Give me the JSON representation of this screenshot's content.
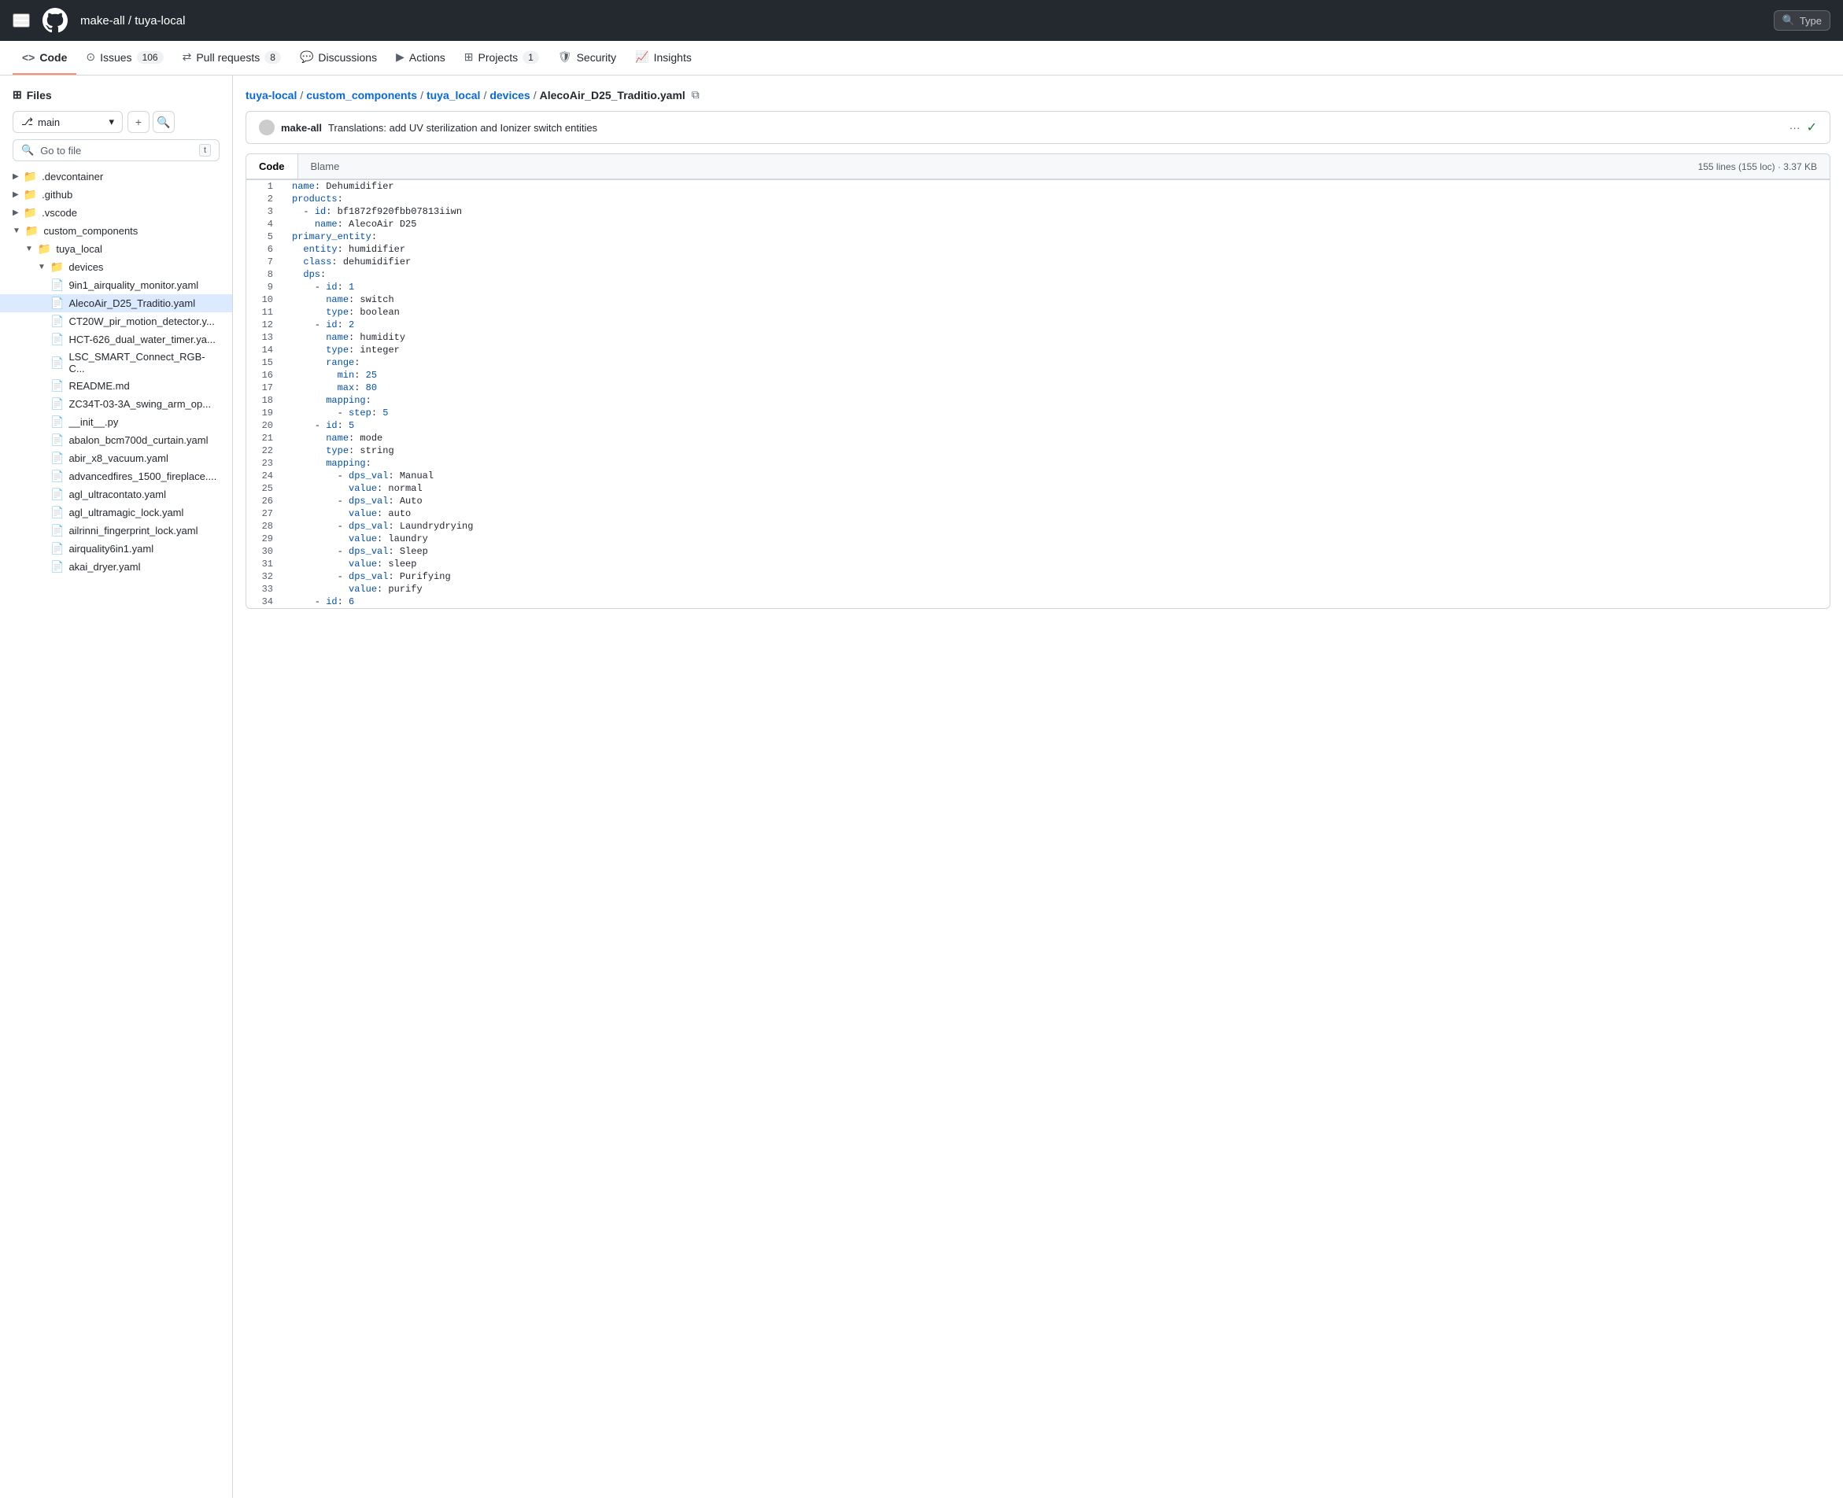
{
  "topNav": {
    "repoOwner": "make-all",
    "repoName": "tuya-local",
    "searchPlaceholder": "Type"
  },
  "tabs": [
    {
      "id": "code",
      "label": "Code",
      "icon": "code",
      "active": true
    },
    {
      "id": "issues",
      "label": "Issues",
      "icon": "circle-dot",
      "badge": "106"
    },
    {
      "id": "pulls",
      "label": "Pull requests",
      "icon": "git-pull-request",
      "badge": "8"
    },
    {
      "id": "discussions",
      "label": "Discussions",
      "icon": "comment"
    },
    {
      "id": "actions",
      "label": "Actions",
      "icon": "play-circle"
    },
    {
      "id": "projects",
      "label": "Projects",
      "icon": "table",
      "badge": "1"
    },
    {
      "id": "security",
      "label": "Security",
      "icon": "shield"
    },
    {
      "id": "insights",
      "label": "Insights",
      "icon": "graph"
    }
  ],
  "sidebar": {
    "filesTitle": "Files",
    "branch": "main",
    "goToFilePlaceholder": "Go to file",
    "goToFileShortcut": "t",
    "tree": [
      {
        "id": "devcontainer",
        "name": ".devcontainer",
        "type": "folder",
        "depth": 0,
        "expanded": false
      },
      {
        "id": "github",
        "name": ".github",
        "type": "folder",
        "depth": 0,
        "expanded": false
      },
      {
        "id": "vscode",
        "name": ".vscode",
        "type": "folder",
        "depth": 0,
        "expanded": false
      },
      {
        "id": "custom_components",
        "name": "custom_components",
        "type": "folder",
        "depth": 0,
        "expanded": true
      },
      {
        "id": "tuya_local",
        "name": "tuya_local",
        "type": "folder",
        "depth": 1,
        "expanded": true
      },
      {
        "id": "devices",
        "name": "devices",
        "type": "folder",
        "depth": 2,
        "expanded": true
      },
      {
        "id": "file_9in1",
        "name": "9in1_airquality_monitor.yaml",
        "type": "file",
        "depth": 3
      },
      {
        "id": "file_aleco",
        "name": "AlecoAir_D25_Traditio.yaml",
        "type": "file",
        "depth": 3,
        "active": true
      },
      {
        "id": "file_ct20w",
        "name": "CT20W_pir_motion_detector.y...",
        "type": "file",
        "depth": 3
      },
      {
        "id": "file_hct",
        "name": "HCT-626_dual_water_timer.ya...",
        "type": "file",
        "depth": 3
      },
      {
        "id": "file_lsc",
        "name": "LSC_SMART_Connect_RGB-C...",
        "type": "file",
        "depth": 3
      },
      {
        "id": "file_readme",
        "name": "README.md",
        "type": "file",
        "depth": 3
      },
      {
        "id": "file_zc34t",
        "name": "ZC34T-03-3A_swing_arm_op...",
        "type": "file",
        "depth": 3
      },
      {
        "id": "file_init",
        "name": "__init__.py",
        "type": "file",
        "depth": 3
      },
      {
        "id": "file_abalon",
        "name": "abalon_bcm700d_curtain.yaml",
        "type": "file",
        "depth": 3
      },
      {
        "id": "file_abir",
        "name": "abir_x8_vacuum.yaml",
        "type": "file",
        "depth": 3
      },
      {
        "id": "file_advfires",
        "name": "advancedfires_1500_fireplace....",
        "type": "file",
        "depth": 3
      },
      {
        "id": "file_agl_ultra",
        "name": "agl_ultracontato.yaml",
        "type": "file",
        "depth": 3
      },
      {
        "id": "file_agl_magic",
        "name": "agl_ultramagic_lock.yaml",
        "type": "file",
        "depth": 3
      },
      {
        "id": "file_ailrinni",
        "name": "ailrinni_fingerprint_lock.yaml",
        "type": "file",
        "depth": 3
      },
      {
        "id": "file_airq6",
        "name": "airquality6in1.yaml",
        "type": "file",
        "depth": 3
      },
      {
        "id": "file_akai",
        "name": "akai_dryer.yaml",
        "type": "file",
        "depth": 3
      }
    ]
  },
  "breadcrumb": {
    "parts": [
      {
        "label": "tuya-local",
        "link": true
      },
      {
        "label": "custom_components",
        "link": true
      },
      {
        "label": "tuya_local",
        "link": true
      },
      {
        "label": "devices",
        "link": true
      },
      {
        "label": "AlecoAir_D25_Traditio.yaml",
        "link": false
      }
    ]
  },
  "commitBar": {
    "author": "make-all",
    "message": "Translations: add UV sterilization and Ionizer switch entities",
    "statusIcon": "✓"
  },
  "codeView": {
    "activeTab": "Code",
    "blameTab": "Blame",
    "fileInfo": "155 lines (155 loc) · 3.37 KB",
    "lines": [
      {
        "num": 1,
        "code": "name: Dehumidifier"
      },
      {
        "num": 2,
        "code": "products:"
      },
      {
        "num": 3,
        "code": "  - id: bf1872f920fbb07813iiwn"
      },
      {
        "num": 4,
        "code": "    name: AlecoAir D25"
      },
      {
        "num": 5,
        "code": "primary_entity:"
      },
      {
        "num": 6,
        "code": "  entity: humidifier"
      },
      {
        "num": 7,
        "code": "  class: dehumidifier"
      },
      {
        "num": 8,
        "code": "  dps:"
      },
      {
        "num": 9,
        "code": "    - id: 1"
      },
      {
        "num": 10,
        "code": "      name: switch"
      },
      {
        "num": 11,
        "code": "      type: boolean"
      },
      {
        "num": 12,
        "code": "    - id: 2"
      },
      {
        "num": 13,
        "code": "      name: humidity"
      },
      {
        "num": 14,
        "code": "      type: integer"
      },
      {
        "num": 15,
        "code": "      range:"
      },
      {
        "num": 16,
        "code": "        min: 25"
      },
      {
        "num": 17,
        "code": "        max: 80"
      },
      {
        "num": 18,
        "code": "      mapping:"
      },
      {
        "num": 19,
        "code": "        - step: 5"
      },
      {
        "num": 20,
        "code": "    - id: 5"
      },
      {
        "num": 21,
        "code": "      name: mode"
      },
      {
        "num": 22,
        "code": "      type: string"
      },
      {
        "num": 23,
        "code": "      mapping:"
      },
      {
        "num": 24,
        "code": "        - dps_val: Manual"
      },
      {
        "num": 25,
        "code": "          value: normal"
      },
      {
        "num": 26,
        "code": "        - dps_val: Auto"
      },
      {
        "num": 27,
        "code": "          value: auto"
      },
      {
        "num": 28,
        "code": "        - dps_val: Laundrydrying"
      },
      {
        "num": 29,
        "code": "          value: laundry"
      },
      {
        "num": 30,
        "code": "        - dps_val: Sleep"
      },
      {
        "num": 31,
        "code": "          value: sleep"
      },
      {
        "num": 32,
        "code": "        - dps_val: Purifying"
      },
      {
        "num": 33,
        "code": "          value: purify"
      },
      {
        "num": 34,
        "code": "    - id: 6"
      }
    ]
  }
}
